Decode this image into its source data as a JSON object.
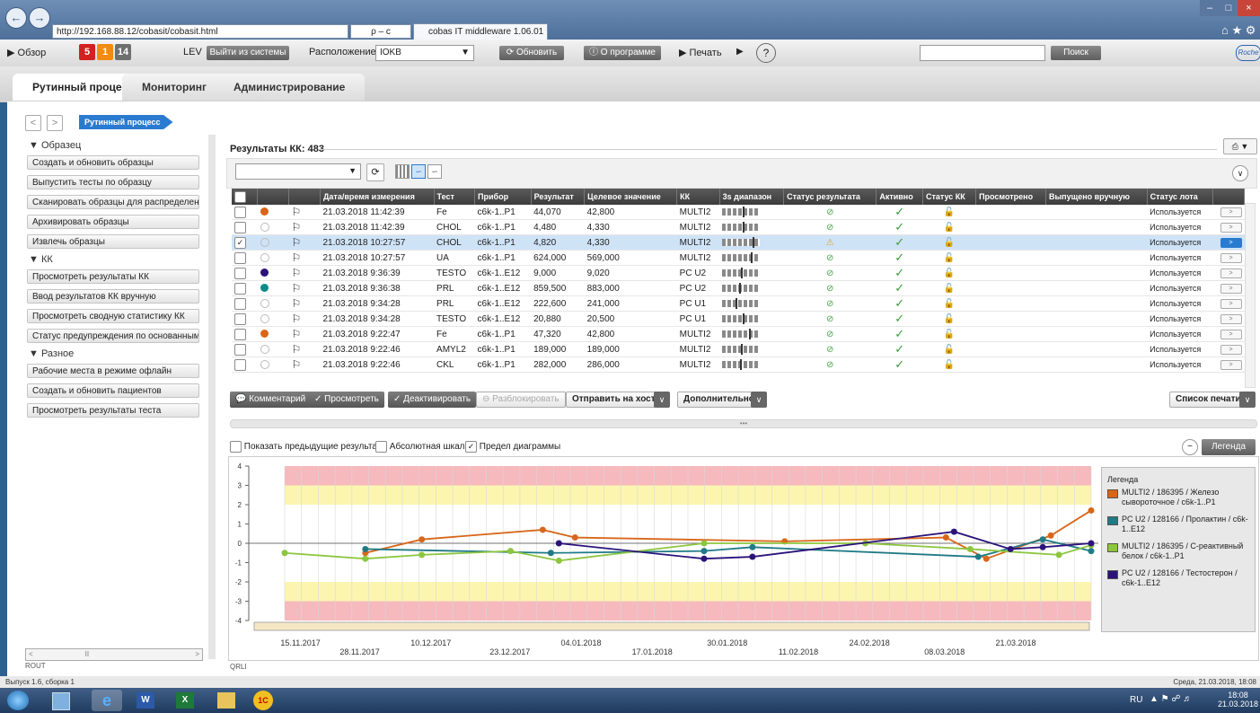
{
  "browser": {
    "url": "http://192.168.88.12/cobasit/cobasit.html",
    "search_hint": "ρ – с",
    "tab_title": "cobas IT middleware 1.06.01",
    "tab_close": "×"
  },
  "toolbar": {
    "overview": "▶ Обзор",
    "counts": [
      "5",
      "1",
      "14"
    ],
    "user": "LEV",
    "logout": "Выйти из системы",
    "location_label": "Расположение",
    "location_value": "IOKB",
    "refresh": "Обновить",
    "about": "О программе",
    "print": "▶ Печать",
    "search_btn": "Поиск",
    "logo": "Roche",
    "help": "?"
  },
  "tabs": [
    "Рутинный процесс",
    "Мониторинг",
    "Администрирование"
  ],
  "breadcrumb": "Рутинный процесс",
  "sidebar": {
    "sections": [
      {
        "title": "▼ Образец",
        "items": [
          "Создать и обновить образцы",
          "Выпустить тесты по образцу",
          "Сканировать образцы для распределения",
          "Архивировать образцы",
          "Извлечь образцы"
        ]
      },
      {
        "title": "▼ КК",
        "items": [
          "Просмотреть результаты КК",
          "Ввод результатов КК вручную",
          "Просмотреть сводную статистику КК",
          "Статус предупреждения по основанным на"
        ]
      },
      {
        "title": "▼ Разное",
        "items": [
          "Рабочие места в режиме офлайн",
          "Создать и обновить пациентов",
          "Просмотреть результаты теста"
        ]
      }
    ],
    "footer": "ROUT"
  },
  "results": {
    "title": "Результаты КК: 483",
    "columns": [
      "Дата/время измерения",
      "Тест",
      "Прибор",
      "Результат",
      "Целевое значение",
      "КК",
      "3s диапазон",
      "Статус результата",
      "Активно",
      "Статус КК",
      "Просмотрено",
      "Выпущено вручную",
      "Статус лота"
    ],
    "rows": [
      {
        "dot": "#d8661a",
        "date": "21.03.2018 11:42:39",
        "test": "Fe",
        "device": "c6k-1..P1",
        "result": "44,070",
        "target": "42,800",
        "qc": "MULTI2",
        "pos": 0.55,
        "status": "ok",
        "lot": "Используется",
        "selected": false
      },
      {
        "dot": "",
        "date": "21.03.2018 11:42:39",
        "test": "CHOL",
        "device": "c6k-1..P1",
        "result": "4,480",
        "target": "4,330",
        "qc": "MULTI2",
        "pos": 0.55,
        "status": "ok",
        "lot": "Используется",
        "selected": false
      },
      {
        "dot": "",
        "date": "21.03.2018 10:27:57",
        "test": "CHOL",
        "device": "c6k-1..P1",
        "result": "4,820",
        "target": "4,330",
        "qc": "MULTI2",
        "pos": 0.8,
        "status": "warn",
        "lot": "Используется",
        "selected": true
      },
      {
        "dot": "",
        "date": "21.03.2018 10:27:57",
        "test": "UA",
        "device": "c6k-1..P1",
        "result": "624,000",
        "target": "569,000",
        "qc": "MULTI2",
        "pos": 0.75,
        "status": "ok",
        "lot": "Используется",
        "selected": false
      },
      {
        "dot": "#2b137a",
        "date": "21.03.2018 9:36:39",
        "test": "TESTO",
        "device": "c6k-1..E12",
        "result": "9,000",
        "target": "9,020",
        "qc": "PC U2",
        "pos": 0.5,
        "status": "ok",
        "lot": "Используется",
        "selected": false
      },
      {
        "dot": "#0d8a8a",
        "date": "21.03.2018 9:36:38",
        "test": "PRL",
        "device": "c6k-1..E12",
        "result": "859,500",
        "target": "883,000",
        "qc": "PC U2",
        "pos": 0.45,
        "status": "ok",
        "lot": "Используется",
        "selected": false
      },
      {
        "dot": "",
        "date": "21.03.2018 9:34:28",
        "test": "PRL",
        "device": "c6k-1..E12",
        "result": "222,600",
        "target": "241,000",
        "qc": "PC U1",
        "pos": 0.35,
        "status": "ok",
        "lot": "Используется",
        "selected": false
      },
      {
        "dot": "",
        "date": "21.03.2018 9:34:28",
        "test": "TESTO",
        "device": "c6k-1..E12",
        "result": "20,880",
        "target": "20,500",
        "qc": "PC U1",
        "pos": 0.55,
        "status": "ok",
        "lot": "Используется",
        "selected": false
      },
      {
        "dot": "#d8661a",
        "date": "21.03.2018 9:22:47",
        "test": "Fe",
        "device": "c6k-1..P1",
        "result": "47,320",
        "target": "42,800",
        "qc": "MULTI2",
        "pos": 0.7,
        "status": "ok",
        "lot": "Используется",
        "selected": false
      },
      {
        "dot": "",
        "date": "21.03.2018 9:22:46",
        "test": "AMYL2",
        "device": "c6k-1..P1",
        "result": "189,000",
        "target": "189,000",
        "qc": "MULTI2",
        "pos": 0.5,
        "status": "ok",
        "lot": "Используется",
        "selected": false
      },
      {
        "dot": "",
        "date": "21.03.2018 9:22:46",
        "test": "CKL",
        "device": "c6k-1..P1",
        "result": "282,000",
        "target": "286,000",
        "qc": "MULTI2",
        "pos": 0.48,
        "status": "ok",
        "lot": "Используется",
        "selected": false
      }
    ]
  },
  "actions": {
    "comment": "Комментарий",
    "view": "Просмотреть",
    "deactivate": "Деактивировать",
    "unlock": "Разблокировать",
    "send_host": "Отправить на хост",
    "more": "Дополнительно",
    "print_list": "Список печати"
  },
  "chart_opts": {
    "prev": "Показать предыдущие результаты",
    "abs": "Абсолютная шкала",
    "limit": "Предел диаграммы",
    "legend_btn": "Легенда"
  },
  "chart_data": {
    "type": "line",
    "ylim": [
      -4,
      4
    ],
    "yticks": [
      "4",
      "3",
      "2",
      "1",
      "0",
      "-1",
      "-2",
      "-3",
      "-4"
    ],
    "xticks_top": [
      "15.11.2017",
      "10.12.2017",
      "04.01.2018",
      "30.01.2018",
      "24.02.2018",
      "21.03.2018"
    ],
    "xticks_bottom": [
      "28.11.2017",
      "23.12.2017",
      "17.01.2018",
      "11.02.2018",
      "08.03.2018"
    ],
    "legend_title": "Легенда",
    "series": [
      {
        "name": "MULTI2 / 186395 / Железо сывороточное / c6k-1..P1",
        "color": "#d8661a",
        "x": [
          0.1,
          0.17,
          0.32,
          0.36,
          0.62,
          0.82,
          0.87,
          0.95,
          1.0
        ],
        "y": [
          -0.5,
          0.2,
          0.7,
          0.3,
          0.1,
          0.3,
          -0.8,
          0.4,
          1.7
        ]
      },
      {
        "name": "PC U2 / 128166 / Пролактин / c6k-1..E12",
        "color": "#1f7a86",
        "x": [
          0.1,
          0.33,
          0.52,
          0.58,
          0.86,
          0.94,
          1.0
        ],
        "y": [
          -0.3,
          -0.5,
          -0.4,
          -0.2,
          -0.7,
          0.2,
          -0.4
        ]
      },
      {
        "name": "MULTI2 / 186395 / C-реактивный белок / c6k-1..P1",
        "color": "#8cc63f",
        "x": [
          0.0,
          0.1,
          0.17,
          0.28,
          0.34,
          0.52,
          0.72,
          0.85,
          0.96,
          1.0
        ],
        "y": [
          -0.5,
          -0.8,
          -0.6,
          -0.4,
          -0.9,
          0.0,
          0.0,
          -0.3,
          -0.6,
          -0.1
        ]
      },
      {
        "name": "PC U2 / 128166 / Тестостерон / c6k-1..E12",
        "color": "#2b137a",
        "x": [
          0.34,
          0.52,
          0.58,
          0.83,
          0.9,
          0.94,
          1.0
        ],
        "y": [
          0.0,
          -0.8,
          -0.7,
          0.6,
          -0.3,
          -0.2,
          0.0
        ]
      }
    ]
  },
  "status": {
    "left": "Выпуск 1.6, сборка 1",
    "right": "Среда, 21.03.2018, 18:08",
    "qrli": "QRLI"
  },
  "taskbar": {
    "lang": "RU",
    "time": "18:08",
    "date": "21.03.2018"
  }
}
